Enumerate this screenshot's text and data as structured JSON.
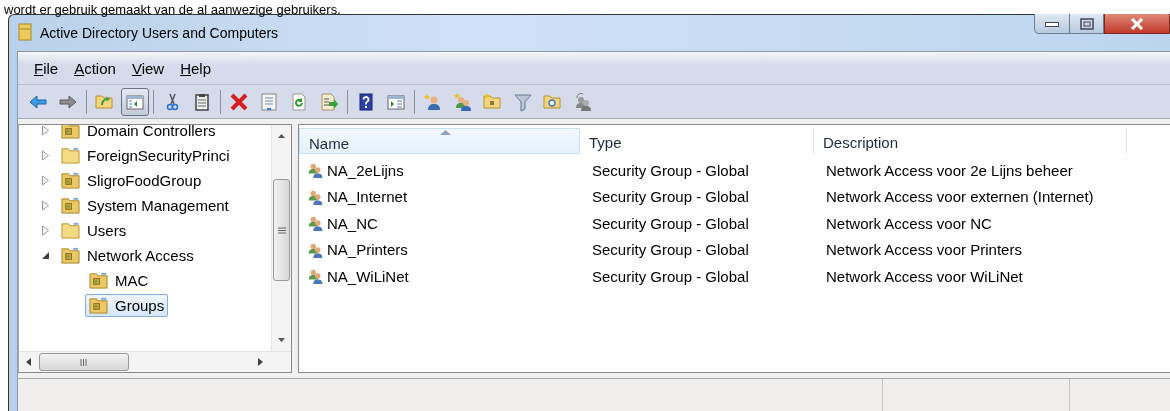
{
  "document_text": "wordt er gebruik gemaakt van de al aanwezige gebruikers.",
  "window": {
    "title": "Active Directory Users and Computers"
  },
  "menu": [
    {
      "label": "File"
    },
    {
      "label": "Action"
    },
    {
      "label": "View"
    },
    {
      "label": "Help"
    }
  ],
  "toolbar": [
    [
      {
        "kind": "back",
        "pressed": false
      },
      {
        "kind": "forward",
        "pressed": false
      }
    ],
    [
      {
        "kind": "up",
        "pressed": false
      },
      {
        "kind": "tree",
        "pressed": true
      }
    ],
    [
      {
        "kind": "cut",
        "pressed": false
      },
      {
        "kind": "paste",
        "pressed": false
      }
    ],
    [
      {
        "kind": "delete",
        "pressed": false
      },
      {
        "kind": "properties",
        "pressed": false
      },
      {
        "kind": "refresh",
        "pressed": false
      },
      {
        "kind": "export",
        "pressed": false
      }
    ],
    [
      {
        "kind": "help",
        "pressed": false
      },
      {
        "kind": "pane",
        "pressed": false
      }
    ],
    [
      {
        "kind": "newuser",
        "pressed": false
      },
      {
        "kind": "newgroup",
        "pressed": false
      },
      {
        "kind": "newou",
        "pressed": false
      },
      {
        "kind": "filter",
        "pressed": false
      },
      {
        "kind": "find",
        "pressed": false
      },
      {
        "kind": "delegate",
        "pressed": false
      }
    ]
  ],
  "tree": [
    {
      "label": "Domain Controllers",
      "kind": "ou",
      "expanded": false,
      "selected": false
    },
    {
      "label": "ForeignSecurityPrinci",
      "kind": "container",
      "expanded": false,
      "selected": false
    },
    {
      "label": "SligroFoodGroup",
      "kind": "ou",
      "expanded": false,
      "selected": false
    },
    {
      "label": "System Management",
      "kind": "ou",
      "expanded": false,
      "selected": false
    },
    {
      "label": "Users",
      "kind": "container",
      "expanded": false,
      "selected": false
    },
    {
      "label": "Network Access",
      "kind": "ou",
      "expanded": true,
      "selected": false,
      "children": [
        {
          "label": "MAC",
          "kind": "ou",
          "selected": false
        },
        {
          "label": "Groups",
          "kind": "ou",
          "selected": true
        }
      ]
    }
  ],
  "table": {
    "columns": [
      {
        "label": "Name",
        "sorted": true
      },
      {
        "label": "Type",
        "sorted": false
      },
      {
        "label": "Description",
        "sorted": false
      }
    ],
    "rows": [
      {
        "name": "NA_2eLijns",
        "type": "Security Group - Global",
        "description": "Network Access voor 2e Lijns beheer"
      },
      {
        "name": "NA_Internet",
        "type": "Security Group - Global",
        "description": "Network Access voor externen (Internet)"
      },
      {
        "name": "NA_NC",
        "type": "Security Group - Global",
        "description": "Network Access voor NC"
      },
      {
        "name": "NA_Printers",
        "type": "Security Group - Global",
        "description": "Network Access voor Printers"
      },
      {
        "name": "NA_WiLiNet",
        "type": "Security Group - Global",
        "description": "Network Access voor WiLiNet"
      }
    ]
  }
}
